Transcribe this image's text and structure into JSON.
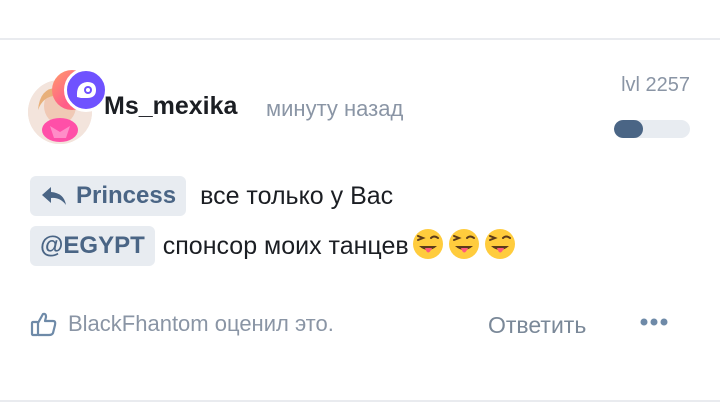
{
  "comment": {
    "author": "Ms_mexika",
    "time": "минуту назад",
    "level_label": "lvl 2257",
    "level_progress": 0.38,
    "reply_to": "Princess",
    "line1_text": "все только у Вас",
    "mention": "@EGYPT",
    "line2_text": "спонсор моих танцев",
    "emojis": [
      "winking-tongue-face",
      "winking-tongue-face",
      "winking-tongue-face"
    ],
    "likes_text": "BlackFhantom оценил это.",
    "reply_label": "Ответить",
    "icons": {
      "reply": "reply-arrow-icon",
      "like": "thumbs-up-icon",
      "more": "more-dots-icon",
      "badge": "ghost-badge-icon"
    },
    "colors": {
      "accent": "#4a6585",
      "muted": "#8a95a5",
      "chip_bg": "#e8ecf1",
      "badge": "#6f52ff"
    }
  }
}
